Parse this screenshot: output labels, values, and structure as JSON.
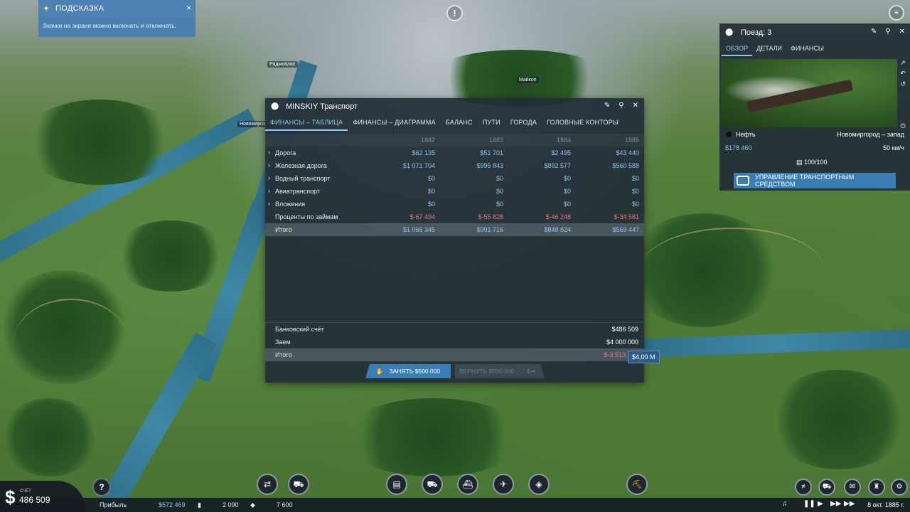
{
  "hint": {
    "title": "ПОДСКАЗКА",
    "text": "Значки на экране можно включать и отключать.",
    "close": "×"
  },
  "map_labels": [
    "Радьювлюг",
    "Майкоп",
    "Новомиргород"
  ],
  "top": {
    "alert_icon": "!",
    "menu_icon": "≡"
  },
  "finance_window": {
    "title": "MINSKIY Транспорт",
    "tabs": [
      "ФИНАНСЫ – ТАБЛИЦА",
      "ФИНАНСЫ – ДИАГРАММА",
      "БАЛАНС",
      "ПУТИ",
      "ГОРОДА",
      "ГОЛОВНЫЕ КОНТОРЫ"
    ],
    "years": [
      "1882",
      "1883",
      "1884",
      "1885"
    ],
    "rows": [
      {
        "label": "Дорога",
        "values": [
          "$62 135",
          "$51 701",
          "$2 495",
          "$43 440"
        ],
        "neg": false,
        "expandable": true
      },
      {
        "label": "Железная дорога",
        "values": [
          "$1 071 704",
          "$995 843",
          "$892 577",
          "$560 588"
        ],
        "neg": false,
        "expandable": true
      },
      {
        "label": "Водный транспорт",
        "values": [
          "$0",
          "$0",
          "$0",
          "$0"
        ],
        "neg": false,
        "expandable": true
      },
      {
        "label": "Авиатранспорт",
        "values": [
          "$0",
          "$0",
          "$0",
          "$0"
        ],
        "neg": false,
        "expandable": true
      },
      {
        "label": "Вложения",
        "values": [
          "$0",
          "$0",
          "$0",
          "$0"
        ],
        "neg": false,
        "expandable": true
      },
      {
        "label": "Проценты по займам",
        "values": [
          "$-67 494",
          "$-55 828",
          "$-46 248",
          "$-34 581"
        ],
        "neg": true,
        "expandable": false
      },
      {
        "label": "Итого",
        "values": [
          "$1 066 345",
          "$991 716",
          "$848 824",
          "$569 447"
        ],
        "neg": false,
        "expandable": false
      }
    ],
    "balance": {
      "bank_label": "Банковский счёт",
      "bank_value": "$486 509",
      "loan_label": "Заем",
      "loan_value": "$4 000 000",
      "total_label": "Итого",
      "total_value": "$-3 513"
    },
    "tooltip": "$4,00 M",
    "borrow_label": "ЗАНЯТЬ $500 000",
    "repay_label": "ВЕРНУТЬ $500 000"
  },
  "vehicle_window": {
    "title": "Поезд: 3",
    "tabs": [
      "ОБЗОР",
      "ДЕТАЛИ",
      "ФИНАНСЫ"
    ],
    "cargo": "Нефть",
    "route": "Новомиргород – запад",
    "money": "$178 460",
    "speed": "50 км/ч",
    "capacity": "100/100",
    "manage_label": "УПРАВЛЕНИЕ ТРАНСПОРТНЫМ СРЕДСТВОМ"
  },
  "bottom": {
    "account_label": "СЧЁТ",
    "account_value": "486 509",
    "profit_label": "Прибыль",
    "profit_value": "$572 469",
    "stat1": "2 090",
    "stat2": "7 600",
    "date": "8 окт. 1885 г."
  },
  "colors": {
    "accent": "#3a7db5",
    "positive": "#8fc3ea",
    "negative": "#e07777",
    "panel": "#222d37"
  }
}
